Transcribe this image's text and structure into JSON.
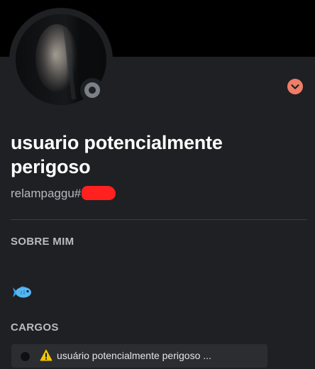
{
  "profile": {
    "display_name": "usuario potencialmente perigoso",
    "username_prefix": "relampaggu#",
    "status": "offline",
    "menu_icon": "chevron-down-icon"
  },
  "about": {
    "title": "SOBRE MIM",
    "content_emoji": "fish-emoji"
  },
  "roles": {
    "title": "CARGOS",
    "items": [
      {
        "label": "usuário potencialmente perigoso ...",
        "icon": "warning-icon"
      }
    ]
  },
  "colors": {
    "background": "#1f2023",
    "banner": "#000000",
    "menu_button": "#f07d67",
    "status_offline": "#7c8087"
  }
}
